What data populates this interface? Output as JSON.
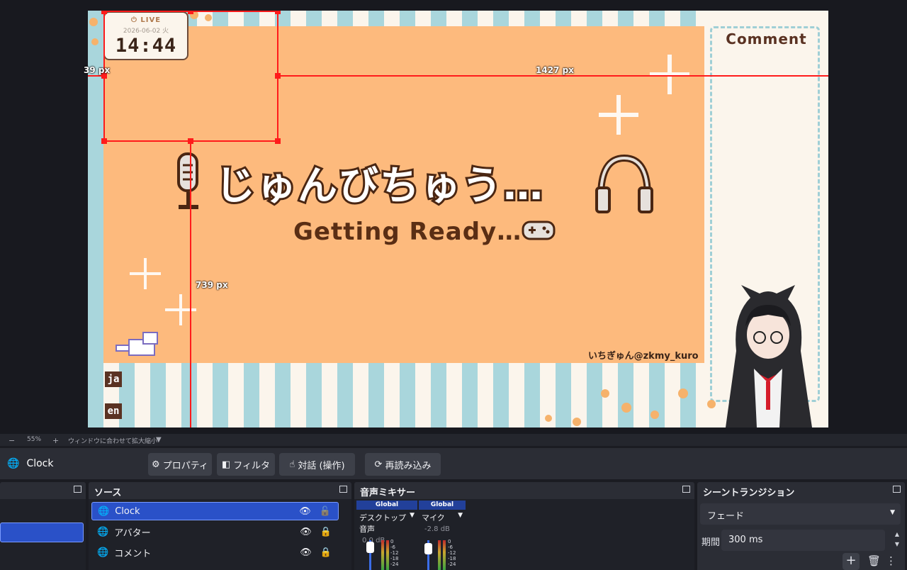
{
  "preview": {
    "clock": {
      "live": "LIVE",
      "date": "2026-06-02 火",
      "time": "14:44"
    },
    "title_main": "じゅんびちゅう…",
    "title_sub": "Getting Ready…",
    "credit": "いちぎゅん@zkmy_kuro",
    "comment_title": "Comment",
    "lang_tags": [
      "ja",
      "en"
    ],
    "dimensions": {
      "left": "39 px",
      "right": "1427 px",
      "bottom": "739 px"
    }
  },
  "zoom_bar": {
    "minus": "−",
    "zoom": "55%",
    "plus": "+",
    "fit": "ウィンドウに合わせて拡大縮小"
  },
  "context": {
    "source_name": "Clock",
    "buttons": {
      "properties": "プロパティ",
      "filters": "フィルタ",
      "interact": "対話 (操作)",
      "refresh": "再読み込み"
    }
  },
  "docks": {
    "sources": {
      "title": "ソース",
      "items": [
        {
          "label": "Clock",
          "selected": true
        },
        {
          "label": "アバター",
          "selected": false
        },
        {
          "label": "コメント",
          "selected": false
        }
      ]
    },
    "mixer": {
      "title": "音声ミキサー",
      "channels": [
        {
          "tag": "Global",
          "name": "デスクトップ音声",
          "db": "0.0 dB"
        },
        {
          "tag": "Global",
          "name": "マイク",
          "db": "-2.8 dB"
        }
      ],
      "scale": [
        "0",
        "-6",
        "-12",
        "-18",
        "-24"
      ]
    },
    "transitions": {
      "title": "シーントランジション",
      "transition": "フェード",
      "duration_label": "期間",
      "duration": "300 ms"
    }
  },
  "colors": {
    "selection": "#2a51c8",
    "overlay_red": "#ff1b1b",
    "stage_orange": "#fdba7d"
  }
}
